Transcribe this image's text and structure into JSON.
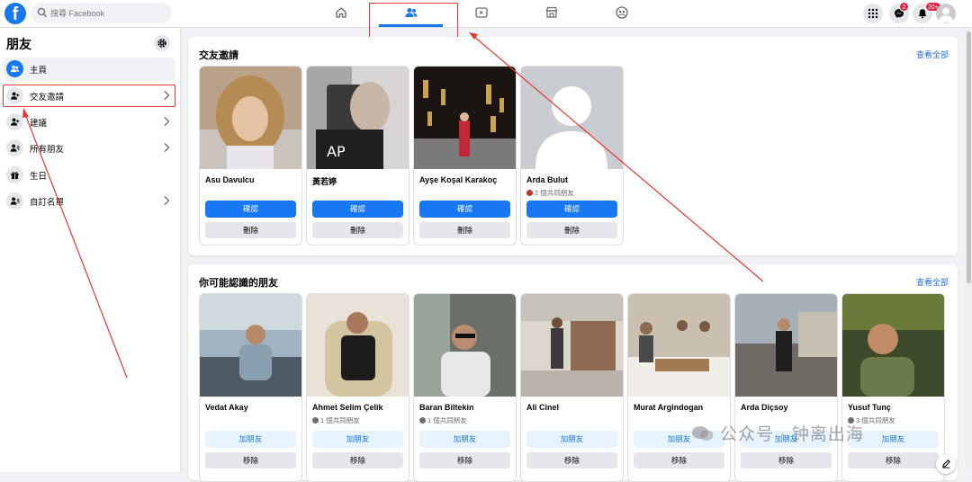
{
  "search": {
    "placeholder": "搜尋 Facebook"
  },
  "brand": {
    "logo_letter": "f",
    "accent": "#1877f2"
  },
  "nav": {
    "icons": [
      "home-icon",
      "friends-icon",
      "watch-icon",
      "marketplace-icon",
      "groups-icon"
    ],
    "active": "friends-icon"
  },
  "top_right": {
    "messenger_badge": "2",
    "notification_badge": "20+"
  },
  "sidebar": {
    "title": "朋友",
    "items": [
      {
        "label": "主頁",
        "icon": "friends-icon",
        "active": true
      },
      {
        "label": "交友邀請",
        "icon": "person-add-icon"
      },
      {
        "label": "建議",
        "icon": "person-suggest-icon"
      },
      {
        "label": "所有朋友",
        "icon": "person-list-icon"
      },
      {
        "label": "生日",
        "icon": "gift-icon"
      },
      {
        "label": "自訂名單",
        "icon": "person-list-icon"
      }
    ]
  },
  "requests": {
    "title": "交友邀請",
    "see_all": "查看全部",
    "cards": [
      {
        "name": "Asu Davulcu",
        "mutual": "",
        "confirm": "確認",
        "delete": "刪除"
      },
      {
        "name": "黃若婷",
        "mutual": "",
        "confirm": "確認",
        "delete": "刪除"
      },
      {
        "name": "Ayşe Koşal Karakoç",
        "mutual": "",
        "confirm": "確認",
        "delete": "刪除"
      },
      {
        "name": "Arda Bulut",
        "mutual": "2 個共同朋友",
        "confirm": "確認",
        "delete": "刪除"
      }
    ]
  },
  "suggestions": {
    "title": "你可能認識的朋友",
    "see_all": "查看全部",
    "cards": [
      {
        "name": "Vedat Akay",
        "mutual": "",
        "add": "加朋友",
        "remove": "移除"
      },
      {
        "name": "Ahmet Selim Çelik",
        "mutual": "1 個共同朋友",
        "add": "加朋友",
        "remove": "移除"
      },
      {
        "name": "Baran Biltekin",
        "mutual": "1 個共同朋友",
        "add": "加朋友",
        "remove": "移除"
      },
      {
        "name": "Ali Cinel",
        "mutual": "",
        "add": "加朋友",
        "remove": "移除"
      },
      {
        "name": "Murat Argindogan",
        "mutual": "",
        "add": "加朋友",
        "remove": "移除"
      },
      {
        "name": "Arda Diçsoy",
        "mutual": "",
        "add": "加朋友",
        "remove": "移除"
      },
      {
        "name": "Yusuf Tunç",
        "mutual": "3 個共同朋友",
        "add": "加朋友",
        "remove": "移除"
      }
    ]
  },
  "watermark": {
    "text": "公众号 · 钟离出海"
  }
}
